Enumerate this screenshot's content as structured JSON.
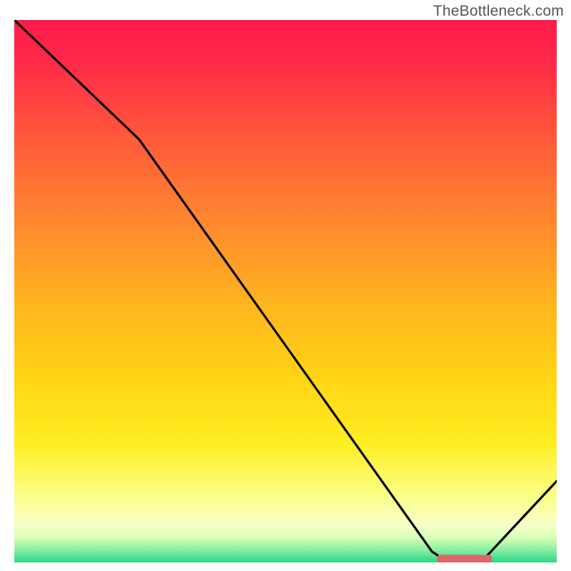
{
  "watermark": "TheBottleneck.com",
  "chart_data": {
    "type": "line",
    "title": "",
    "xlabel": "",
    "ylabel": "",
    "xlim": [
      0,
      100
    ],
    "ylim": [
      0,
      100
    ],
    "curve_x": [
      0,
      23,
      77,
      80,
      86,
      100
    ],
    "curve_y": [
      100,
      78,
      2,
      0,
      0,
      15
    ],
    "flat_band": {
      "x0": 78,
      "x1": 88,
      "y": 0.6,
      "color": "#e06666",
      "thickness": 1.6
    },
    "axes_visible": false,
    "gradient_stops": [
      {
        "offset": 0.0,
        "color": "#ff1a4b"
      },
      {
        "offset": 0.08,
        "color": "#ff2a48"
      },
      {
        "offset": 0.22,
        "color": "#ff5a3a"
      },
      {
        "offset": 0.38,
        "color": "#ff8a2e"
      },
      {
        "offset": 0.52,
        "color": "#ffb41f"
      },
      {
        "offset": 0.66,
        "color": "#ffd414"
      },
      {
        "offset": 0.78,
        "color": "#ffee22"
      },
      {
        "offset": 0.88,
        "color": "#fbff8a"
      },
      {
        "offset": 0.93,
        "color": "#f7ffc8"
      },
      {
        "offset": 0.955,
        "color": "#d7ffb6"
      },
      {
        "offset": 0.975,
        "color": "#8ff2a4"
      },
      {
        "offset": 1.0,
        "color": "#2bd58a"
      }
    ]
  }
}
